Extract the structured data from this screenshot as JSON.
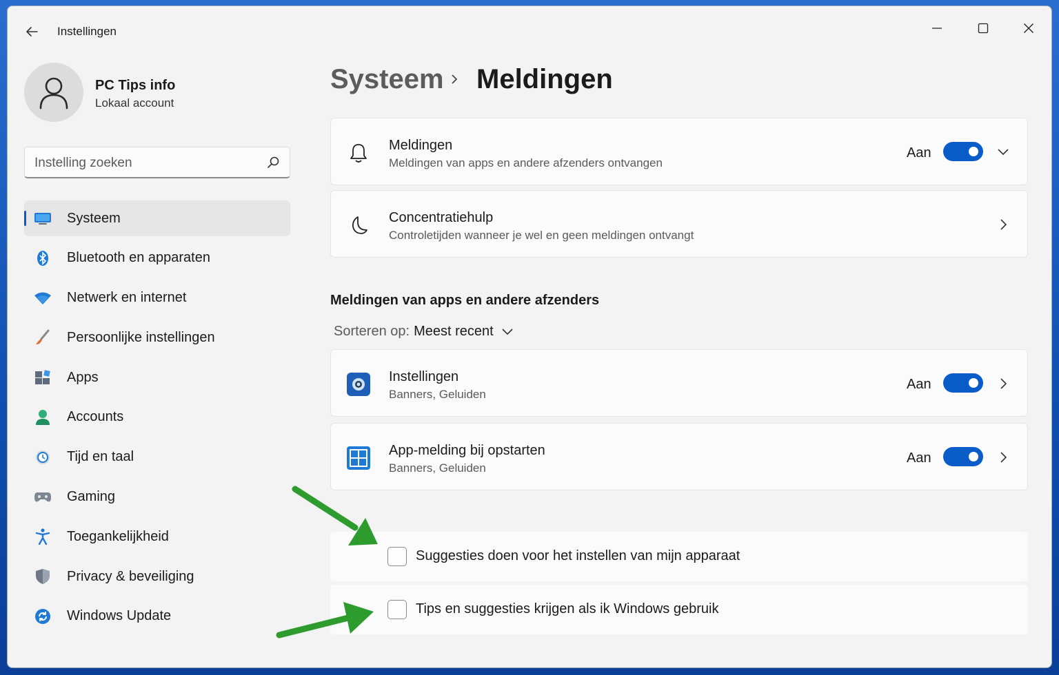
{
  "window": {
    "title": "Instellingen",
    "controls": [
      "minimize",
      "maximize",
      "close"
    ]
  },
  "profile": {
    "name": "PC Tips info",
    "account_type": "Lokaal account"
  },
  "search": {
    "placeholder": "Instelling zoeken",
    "icon": "search-icon"
  },
  "sidebar": {
    "items": [
      {
        "label": "Systeem",
        "icon": "monitor-icon",
        "active": true
      },
      {
        "label": "Bluetooth en apparaten",
        "icon": "bluetooth-icon",
        "active": false
      },
      {
        "label": "Netwerk en internet",
        "icon": "wifi-icon",
        "active": false
      },
      {
        "label": "Persoonlijke instellingen",
        "icon": "brush-icon",
        "active": false
      },
      {
        "label": "Apps",
        "icon": "apps-icon",
        "active": false
      },
      {
        "label": "Accounts",
        "icon": "person-icon",
        "active": false
      },
      {
        "label": "Tijd en taal",
        "icon": "globe-clock-icon",
        "active": false
      },
      {
        "label": "Gaming",
        "icon": "gamepad-icon",
        "active": false
      },
      {
        "label": "Toegankelijkheid",
        "icon": "accessibility-icon",
        "active": false
      },
      {
        "label": "Privacy & beveiliging",
        "icon": "shield-icon",
        "active": false
      },
      {
        "label": "Windows Update",
        "icon": "update-icon",
        "active": false
      }
    ]
  },
  "breadcrumb": {
    "parent": "Systeem",
    "current": "Meldingen"
  },
  "settings": {
    "notifications": {
      "title": "Meldingen",
      "subtitle": "Meldingen van apps en andere afzenders ontvangen",
      "state": "Aan",
      "on": true
    },
    "focus": {
      "title": "Concentratiehulp",
      "subtitle": "Controletijden wanneer je wel en geen meldingen ontvangt"
    }
  },
  "apps_section": {
    "heading": "Meldingen van apps en andere afzenders",
    "sort_label": "Sorteren op:",
    "sort_value": "Meest recent",
    "apps": [
      {
        "title": "Instellingen",
        "subtitle": "Banners, Geluiden",
        "state": "Aan",
        "on": true,
        "icon": "settings-gear-icon"
      },
      {
        "title": "App-melding bij opstarten",
        "subtitle": "Banners, Geluiden",
        "state": "Aan",
        "on": true,
        "icon": "startup-app-icon"
      }
    ]
  },
  "checkboxes": [
    {
      "label": "Suggesties doen voor het instellen van mijn apparaat",
      "checked": false
    },
    {
      "label": "Tips en suggesties krijgen als ik Windows gebruik",
      "checked": false
    }
  ],
  "colors": {
    "accent": "#0a5cc9",
    "annotation_arrow": "#2e9b2e",
    "window_bg": "#f3f3f3",
    "card_bg": "#fbfbfb"
  }
}
